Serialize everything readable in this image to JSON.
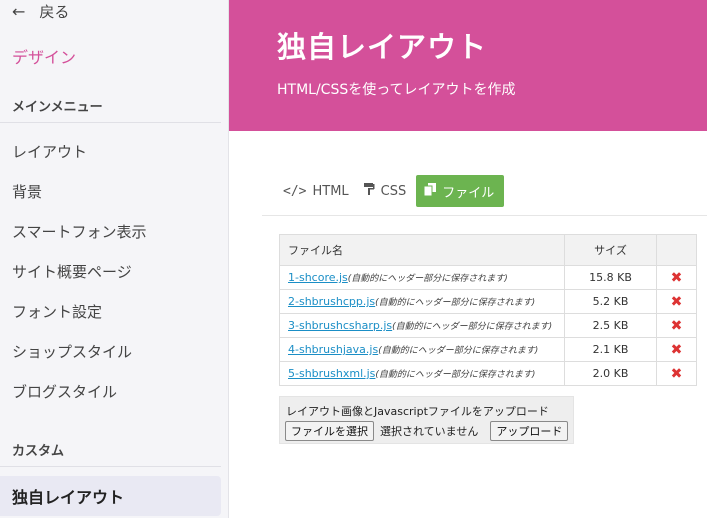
{
  "sidebar": {
    "back_label": "戻る",
    "section_title": "デザイン",
    "group_main": "メインメニュー",
    "items": [
      {
        "label": "レイアウト"
      },
      {
        "label": "背景"
      },
      {
        "label": "スマートフォン表示"
      },
      {
        "label": "サイト概要ページ"
      },
      {
        "label": "フォント設定"
      },
      {
        "label": "ショップスタイル"
      },
      {
        "label": "ブログスタイル"
      }
    ],
    "group_custom": "カスタム",
    "active_item": "独自レイアウト"
  },
  "header": {
    "title": "独自レイアウト",
    "subtitle": "HTML/CSSを使ってレイアウトを作成",
    "color": "#d4509a"
  },
  "tabs": [
    {
      "label": "HTML",
      "icon": "code-icon"
    },
    {
      "label": "CSS",
      "icon": "paint-roller-icon"
    },
    {
      "label": "ファイル",
      "icon": "files-icon",
      "active": true
    }
  ],
  "files_table": {
    "headers": {
      "name": "ファイル名",
      "size": "サイズ"
    },
    "rows": [
      {
        "name": "1-shcore.js",
        "note": "(自動的にヘッダー部分に保存されます)",
        "size": "15.8 KB"
      },
      {
        "name": "2-shbrushcpp.js",
        "note": "(自動的にヘッダー部分に保存されます)",
        "size": "5.2 KB"
      },
      {
        "name": "3-shbrushcsharp.js",
        "note": "(自動的にヘッダー部分に保存されます)",
        "size": "2.5 KB"
      },
      {
        "name": "4-shbrushjava.js",
        "note": "(自動的にヘッダー部分に保存されます)",
        "size": "2.1 KB"
      },
      {
        "name": "5-shbrushxml.js",
        "note": "(自動的にヘッダー部分に保存されます)",
        "size": "2.0 KB"
      }
    ]
  },
  "upload": {
    "label": "レイアウト画像とJavascriptファイルをアップロード",
    "choose_button": "ファイルを選択",
    "no_file": "選択されていません",
    "upload_button": "アップロード"
  }
}
